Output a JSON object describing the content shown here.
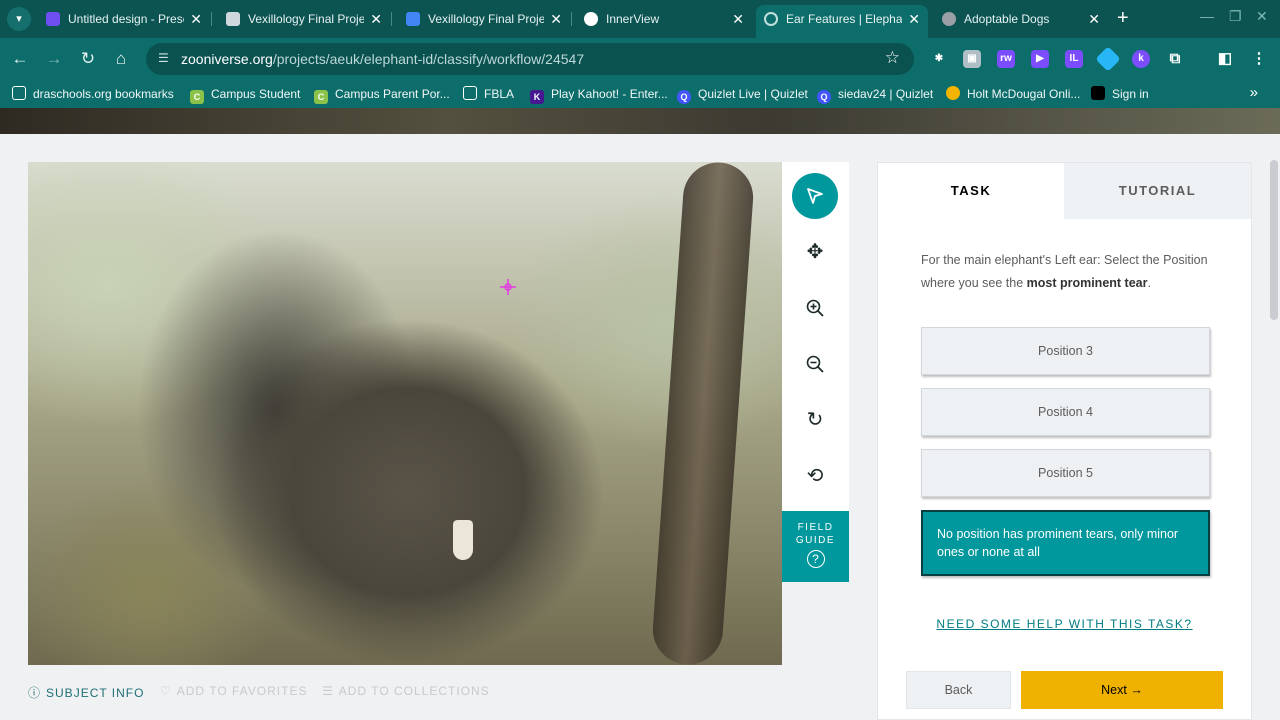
{
  "browser": {
    "tabs": [
      {
        "title": "Untitled design - Prese",
        "favicon_color": "#6f4ff2"
      },
      {
        "title": "Vexillology Final Proje",
        "favicon_color": "#cfd8dc"
      },
      {
        "title": "Vexillology Final Proje",
        "favicon_color": "#4285f4"
      },
      {
        "title": "InnerView",
        "favicon_color": "#ffffff"
      },
      {
        "title": "Ear Features | Elephan",
        "favicon_color": "#0d6d6a",
        "active": true
      },
      {
        "title": "Adoptable Dogs",
        "favicon_color": "#9aa0a6"
      }
    ],
    "new_tab": "+",
    "close_glyph": "✕",
    "url_prefix": "zooniverse.org",
    "url_path": "/projects/aeuk/elephant-id/classify/workflow/24547",
    "bookmarks": [
      {
        "label": "draschools.org bookmarks",
        "icon_color": "#0d6d6a"
      },
      {
        "label": "Campus Student",
        "icon_color": "#8bc34a"
      },
      {
        "label": "Campus Parent Por...",
        "icon_color": "#8bc34a"
      },
      {
        "label": "FBLA",
        "icon_color": "#0d6d6a"
      },
      {
        "label": "Play Kahoot! - Enter...",
        "icon_color": "#46178f"
      },
      {
        "label": "Quizlet Live | Quizlet",
        "icon_color": "#4255ff"
      },
      {
        "label": "siedav24 | Quizlet",
        "icon_color": "#4255ff"
      },
      {
        "label": "Holt McDougal Onli...",
        "icon_color": "#f4b400"
      },
      {
        "label": "Sign in",
        "icon_color": "#000000"
      }
    ]
  },
  "toolbox": {
    "field_guide_label": "FIELD GUIDE",
    "field_guide_icon": "?"
  },
  "subject_meta": {
    "subject_info": "SUBJECT INFO",
    "add_to_favorites": "ADD TO FAVORITES",
    "add_to_collections": "ADD TO COLLECTIONS"
  },
  "task": {
    "tab_task": "TASK",
    "tab_tutorial": "TUTORIAL",
    "instruction_pre": "For the main elephant's Left ear: Select the Position where you see the ",
    "instruction_bold": "most prominent tear",
    "instruction_post": ".",
    "answers": [
      {
        "label": "Position 3"
      },
      {
        "label": "Position 4"
      },
      {
        "label": "Position 5"
      },
      {
        "label": "No position has prominent tears, only minor ones or none at all",
        "selected": true
      }
    ],
    "help_link": "NEED SOME HELP WITH THIS TASK?",
    "back_label": "Back",
    "next_label": "Next →"
  },
  "colors": {
    "accent_teal": "#00979d",
    "next_yellow": "#f0b200",
    "browser_frame": "#0d6d6a"
  }
}
